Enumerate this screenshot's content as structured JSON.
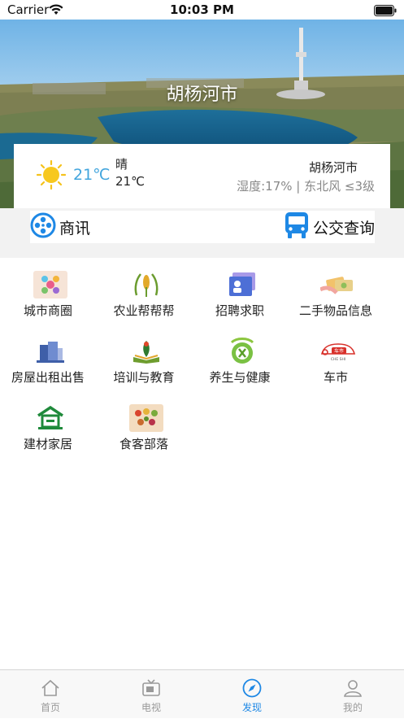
{
  "status_bar": {
    "carrier": "Carrier",
    "time": "10:03 PM"
  },
  "banner": {
    "title": "胡杨河市"
  },
  "weather": {
    "temperature_large": "21℃",
    "condition": "晴",
    "temperature_small": "21℃",
    "city": "胡杨河市",
    "details": "湿度:17% | 东北风 ≤3级",
    "icon": "sun-icon"
  },
  "quick_links": [
    {
      "label": "商讯",
      "icon": "film-reel-icon"
    },
    {
      "label": "公交查询",
      "icon": "bus-icon"
    }
  ],
  "categories": [
    {
      "label": "城市商圈",
      "icon": "city-business-icon"
    },
    {
      "label": "农业帮帮帮",
      "icon": "agriculture-icon"
    },
    {
      "label": "招聘求职",
      "icon": "recruitment-icon"
    },
    {
      "label": "二手物品信息",
      "icon": "secondhand-icon"
    },
    {
      "label": "房屋出租出售",
      "icon": "housing-icon"
    },
    {
      "label": "培训与教育",
      "icon": "education-icon"
    },
    {
      "label": "养生与健康",
      "icon": "health-icon"
    },
    {
      "label": "车市",
      "icon": "car-market-icon",
      "logo_text": "车市",
      "logo_subtext": "CHE SHI"
    },
    {
      "label": "建材家居",
      "icon": "building-materials-icon"
    },
    {
      "label": "食客部落",
      "icon": "food-icon"
    }
  ],
  "tabbar": [
    {
      "label": "首页",
      "icon": "home-icon",
      "active": false
    },
    {
      "label": "电视",
      "icon": "tv-icon",
      "active": false
    },
    {
      "label": "发现",
      "icon": "compass-icon",
      "active": true
    },
    {
      "label": "我的",
      "icon": "person-icon",
      "active": false
    }
  ],
  "colors": {
    "accent": "#1e88e5",
    "temp": "#42a5dd",
    "tab_inactive": "#999999"
  }
}
